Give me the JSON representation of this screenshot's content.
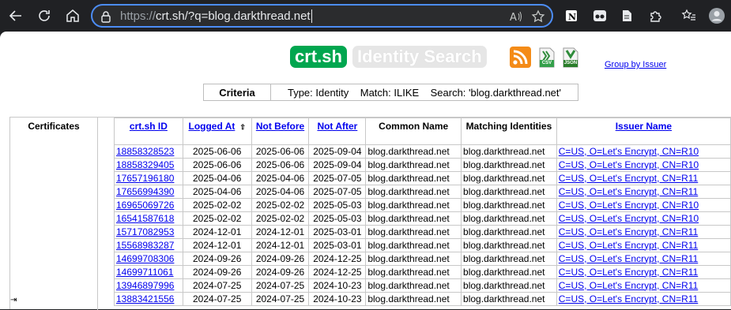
{
  "browser": {
    "url_scheme": "https://",
    "url_host": "crt.sh",
    "url_rest": "/?q=blog.darkthread.net"
  },
  "header": {
    "logo": "crt.sh",
    "subtitle": "Identity Search",
    "csv_label": "CSV",
    "json_label": "JSON",
    "group_link": "Group by Issuer"
  },
  "criteria": {
    "label": "Criteria",
    "value": "Type: Identity    Match: ILIKE    Search: 'blog.darkthread.net'"
  },
  "results": {
    "section_label": "Certificates",
    "columns": {
      "id": "crt.sh ID",
      "logged": "Logged At",
      "not_before": "Not Before",
      "not_after": "Not After",
      "common_name": "Common Name",
      "matching": "Matching Identities",
      "issuer": "Issuer Name"
    },
    "sort_indicator": "⇧",
    "rows": [
      [
        "18858328523",
        "2025-06-06",
        "2025-06-06",
        "2025-09-04",
        "blog.darkthread.net",
        "blog.darkthread.net",
        "C=US, O=Let's Encrypt, CN=R10"
      ],
      [
        "18858329405",
        "2025-06-06",
        "2025-06-06",
        "2025-09-04",
        "blog.darkthread.net",
        "blog.darkthread.net",
        "C=US, O=Let's Encrypt, CN=R10"
      ],
      [
        "17657196180",
        "2025-04-06",
        "2025-04-06",
        "2025-07-05",
        "blog.darkthread.net",
        "blog.darkthread.net",
        "C=US, O=Let's Encrypt, CN=R11"
      ],
      [
        "17656994390",
        "2025-04-06",
        "2025-04-06",
        "2025-07-05",
        "blog.darkthread.net",
        "blog.darkthread.net",
        "C=US, O=Let's Encrypt, CN=R11"
      ],
      [
        "16965069726",
        "2025-02-02",
        "2025-02-02",
        "2025-05-03",
        "blog.darkthread.net",
        "blog.darkthread.net",
        "C=US, O=Let's Encrypt, CN=R10"
      ],
      [
        "16541587618",
        "2025-02-02",
        "2025-02-02",
        "2025-05-03",
        "blog.darkthread.net",
        "blog.darkthread.net",
        "C=US, O=Let's Encrypt, CN=R10"
      ],
      [
        "15717082953",
        "2024-12-01",
        "2024-12-01",
        "2025-03-01",
        "blog.darkthread.net",
        "blog.darkthread.net",
        "C=US, O=Let's Encrypt, CN=R11"
      ],
      [
        "15568983287",
        "2024-12-01",
        "2024-12-01",
        "2025-03-01",
        "blog.darkthread.net",
        "blog.darkthread.net",
        "C=US, O=Let's Encrypt, CN=R11"
      ],
      [
        "14699708306",
        "2024-09-26",
        "2024-09-26",
        "2024-12-25",
        "blog.darkthread.net",
        "blog.darkthread.net",
        "C=US, O=Let's Encrypt, CN=R11"
      ],
      [
        "14699711061",
        "2024-09-26",
        "2024-09-26",
        "2024-12-25",
        "blog.darkthread.net",
        "blog.darkthread.net",
        "C=US, O=Let's Encrypt, CN=R11"
      ],
      [
        "13946897996",
        "2024-07-25",
        "2024-07-25",
        "2024-10-23",
        "blog.darkthread.net",
        "blog.darkthread.net",
        "C=US, O=Let's Encrypt, CN=R11"
      ],
      [
        "13883421556",
        "2024-07-25",
        "2024-07-25",
        "2024-10-23",
        "blog.darkthread.net",
        "blog.darkthread.net",
        "C=US, O=Let's Encrypt, CN=R11"
      ]
    ]
  },
  "colors": {
    "accent": "#4c8df6",
    "logo_green": "#00a64f",
    "link": "#0000ee"
  }
}
